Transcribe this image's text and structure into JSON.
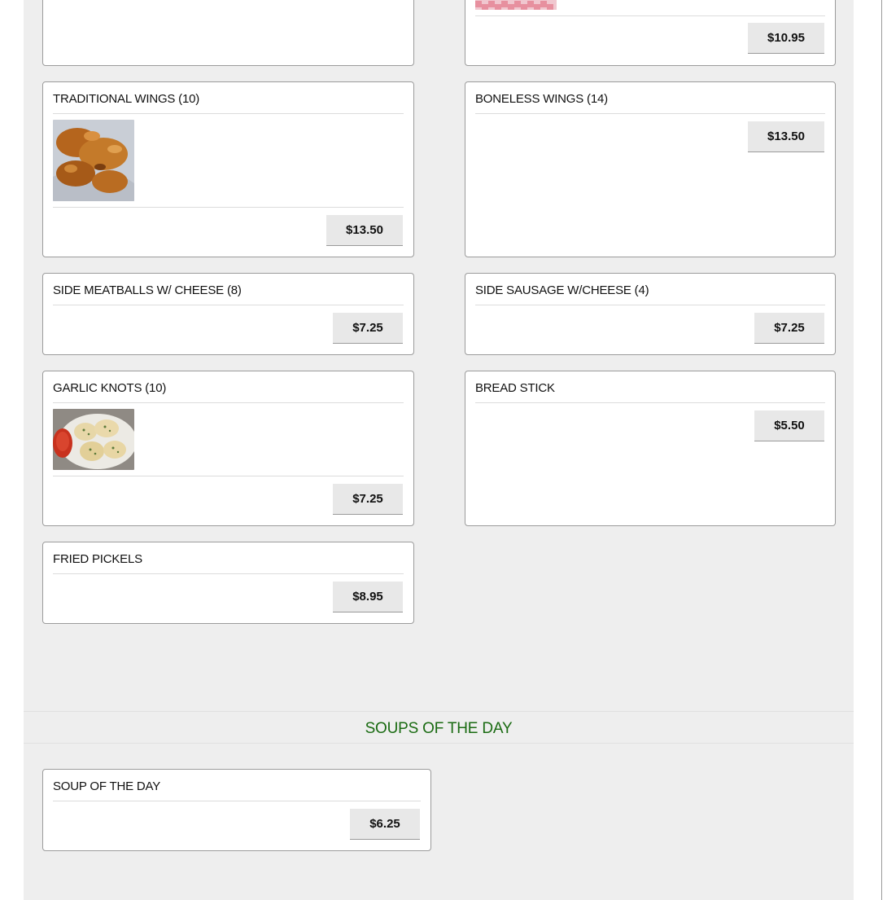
{
  "items": {
    "top_left": {},
    "top_right": {
      "price": "$10.95"
    },
    "traditional_wings": {
      "title": "TRADITIONAL WINGS (10)",
      "price": "$13.50",
      "image": "fried-wings-photo"
    },
    "boneless_wings": {
      "title": "BONELESS WINGS (14)",
      "price": "$13.50"
    },
    "side_meatballs": {
      "title": "SIDE MEATBALLS W/ CHEESE (8)",
      "price": "$7.25"
    },
    "side_sausage": {
      "title": "SIDE SAUSAGE W/CHEESE (4)",
      "price": "$7.25"
    },
    "garlic_knots": {
      "title": "GARLIC KNOTS (10)",
      "price": "$7.25",
      "image": "garlic-knots-photo"
    },
    "bread_stick": {
      "title": "BREAD STICK",
      "price": "$5.50"
    },
    "fried_pickels": {
      "title": "FRIED PICKELS",
      "price": "$8.95"
    }
  },
  "soups_section": {
    "heading": "SOUPS OF THE DAY",
    "items": [
      {
        "title": "SOUP OF THE DAY",
        "price": "$6.25"
      }
    ]
  },
  "colors": {
    "section_heading": "#1a6b12",
    "panel_background": "#eeeeee",
    "button_background": "#e8e8e8"
  }
}
